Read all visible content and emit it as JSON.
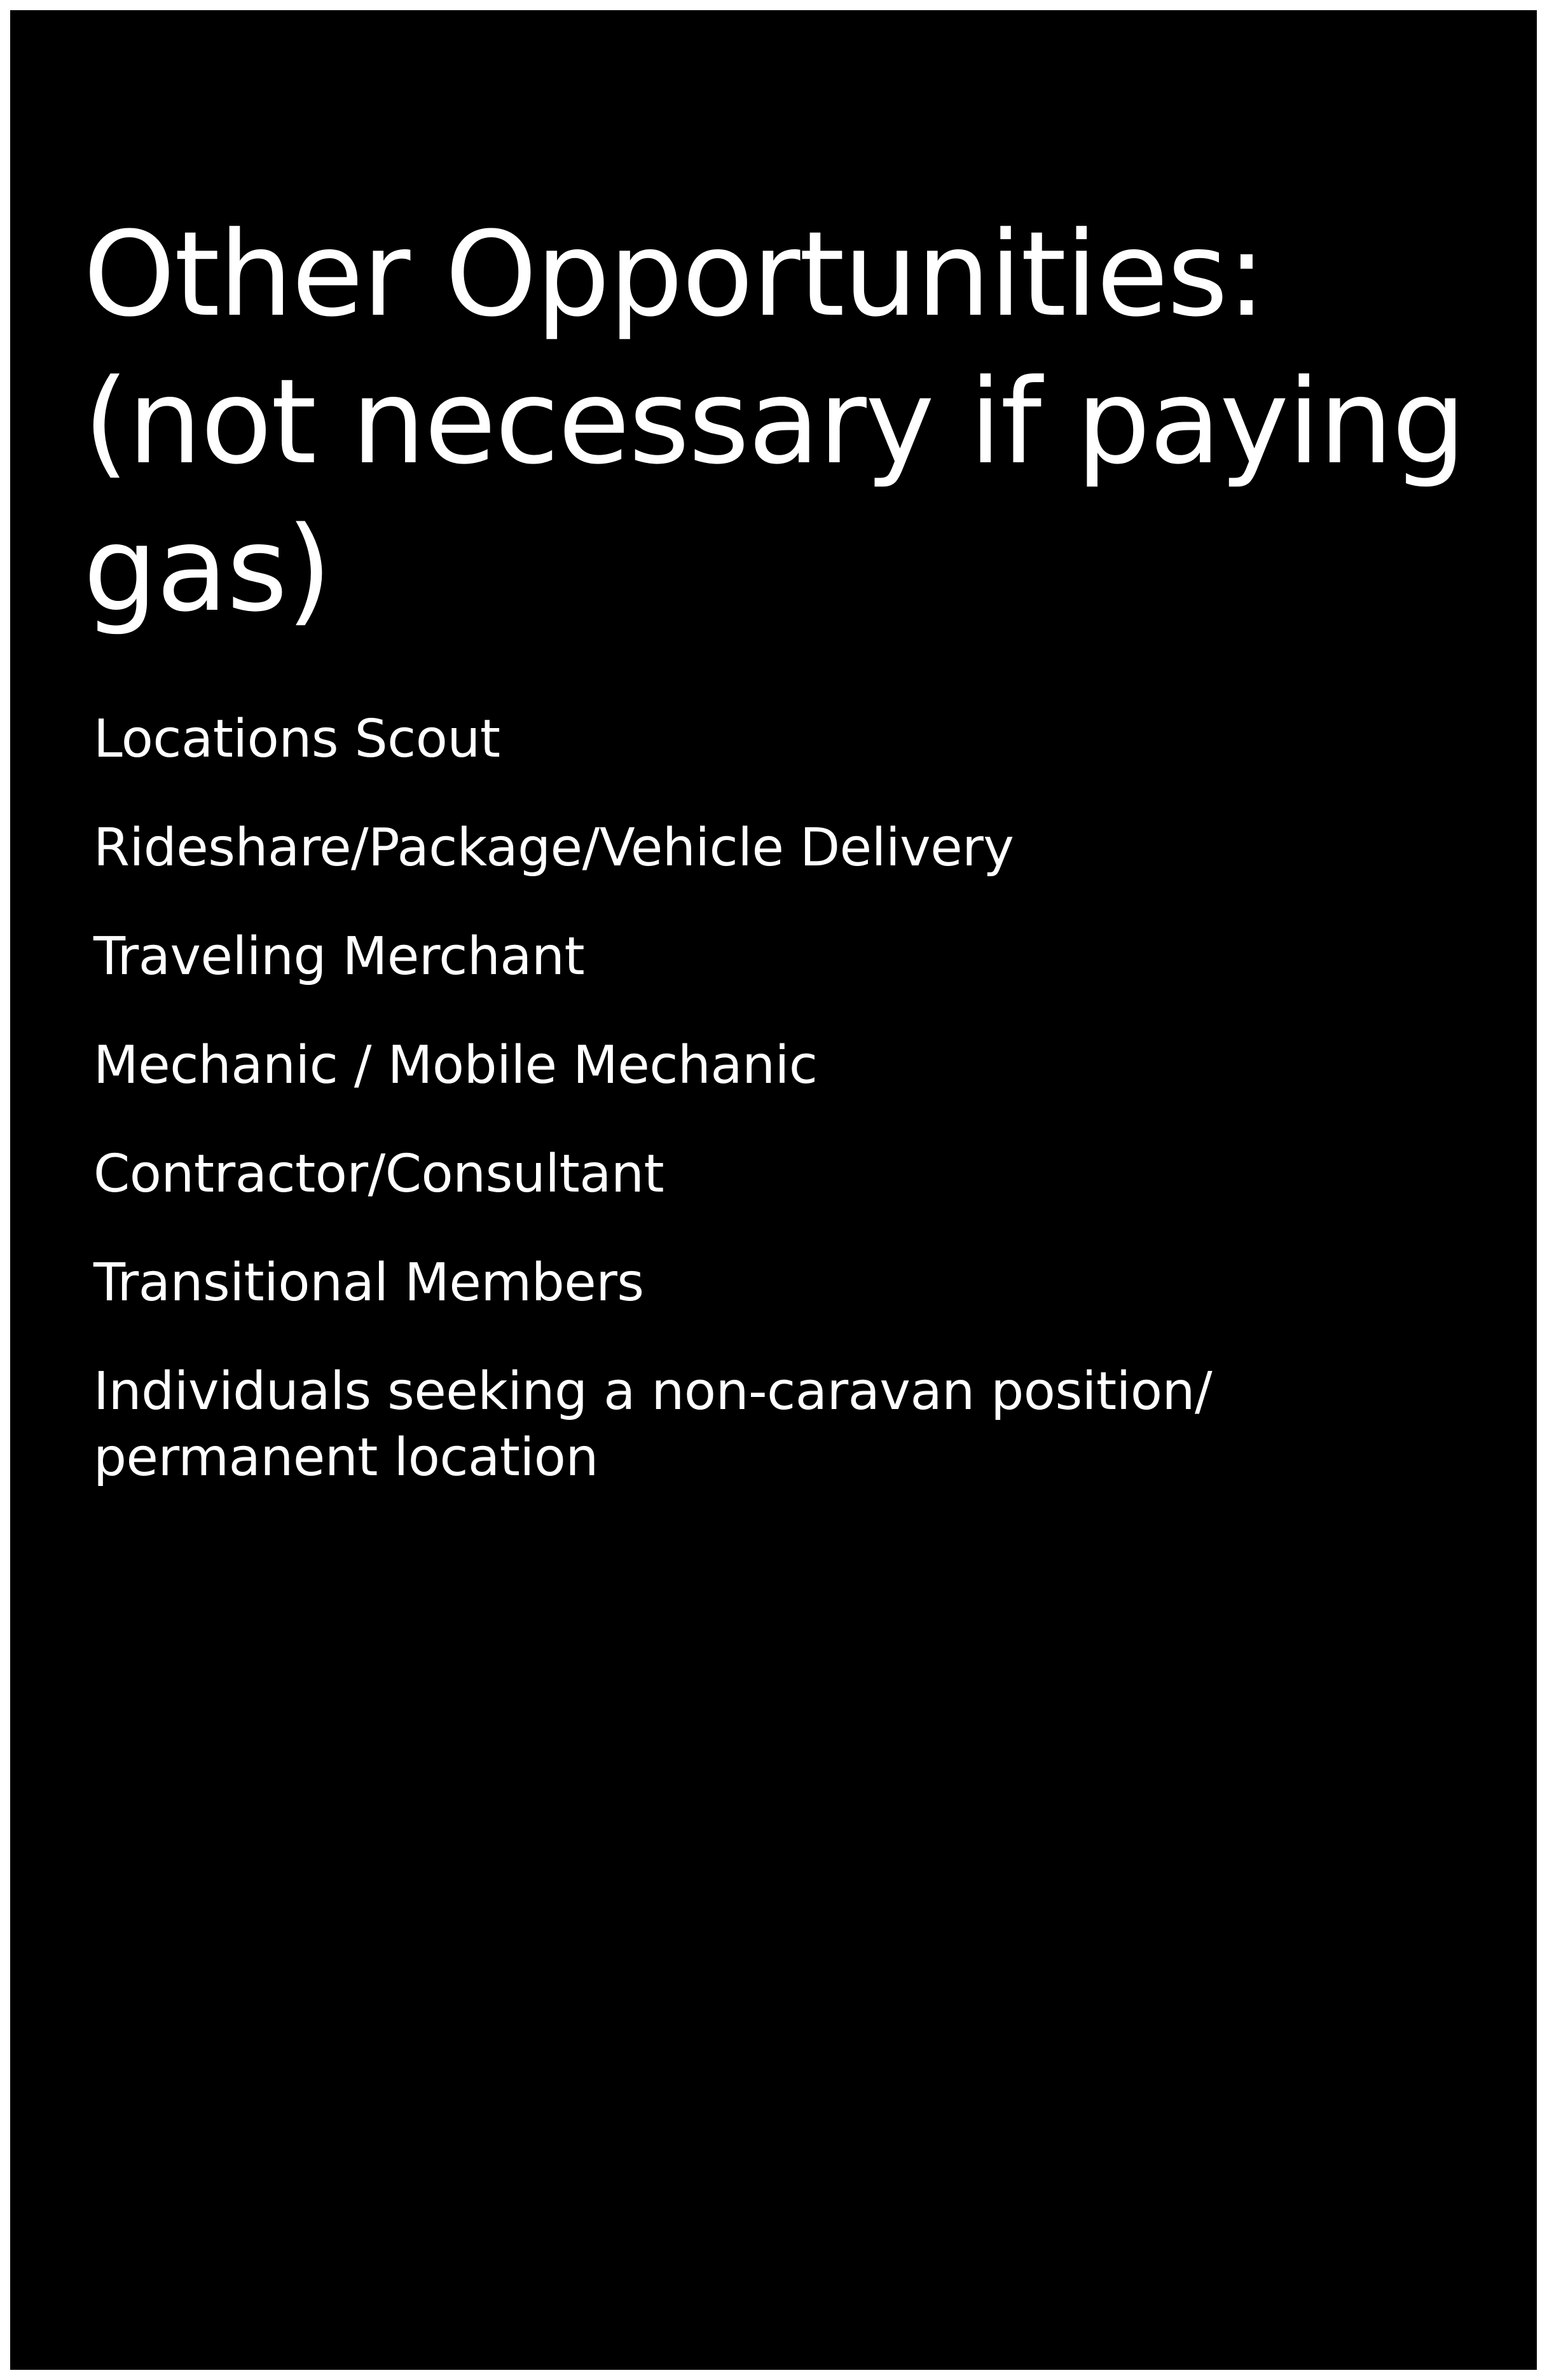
{
  "slide": {
    "title_lines": [
      "Other Opportunities:",
      "(not necessary if paying",
      "gas)"
    ],
    "items": [
      "Locations Scout",
      "Rideshare/Package/Vehicle Delivery",
      "Traveling Merchant",
      "Mechanic / Mobile Mechanic",
      "Contractor/Consultant",
      "Transitional Members",
      "Individuals seeking a non-caravan position/\npermanent location"
    ]
  },
  "colors": {
    "background": "#000000",
    "text": "#ffffff",
    "frame": "#ffffff"
  }
}
